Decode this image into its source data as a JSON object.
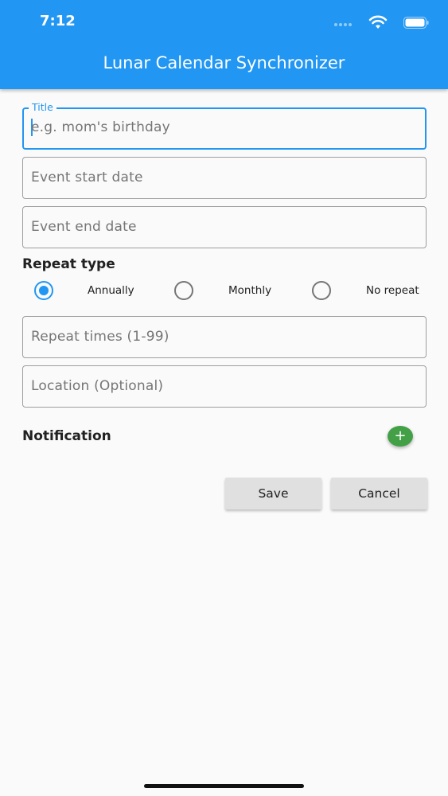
{
  "status_bar": {
    "time": "7:12"
  },
  "app_bar": {
    "title": "Lunar Calendar Synchronizer",
    "color": "#2196f3"
  },
  "form": {
    "title_field": {
      "label": "Title",
      "placeholder": "e.g. mom's birthday"
    },
    "start_date_field": {
      "placeholder": "Event start date"
    },
    "end_date_field": {
      "placeholder": "Event end date"
    },
    "repeat_type": {
      "heading": "Repeat type",
      "options": [
        {
          "label": "Annually",
          "selected": true
        },
        {
          "label": "Monthly",
          "selected": false
        },
        {
          "label": "No repeat",
          "selected": false
        }
      ]
    },
    "repeat_times_field": {
      "placeholder": "Repeat times (1-99)"
    },
    "location_field": {
      "placeholder": "Location (Optional)"
    },
    "notification": {
      "heading": "Notification",
      "add_icon": "plus-icon",
      "add_symbol": "+",
      "add_color": "#43a047"
    }
  },
  "actions": {
    "save_label": "Save",
    "cancel_label": "Cancel"
  }
}
